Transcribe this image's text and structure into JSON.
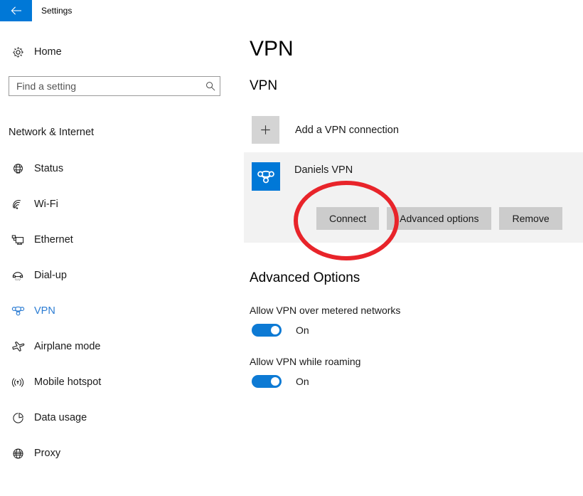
{
  "window": {
    "back_icon": "back-arrow-icon",
    "title": "Settings",
    "accent_color": "#0078d7"
  },
  "sidebar": {
    "home": {
      "icon": "gear-icon",
      "label": "Home"
    },
    "search": {
      "icon": "search-icon",
      "value": "",
      "placeholder": "Find a setting"
    },
    "group_label": "Network & Internet",
    "items": [
      {
        "icon": "globe-icon",
        "label": "Status",
        "selected": false
      },
      {
        "icon": "wifi-icon",
        "label": "Wi-Fi",
        "selected": false
      },
      {
        "icon": "ethernet-icon",
        "label": "Ethernet",
        "selected": false
      },
      {
        "icon": "dialup-phone-icon",
        "label": "Dial-up",
        "selected": false
      },
      {
        "icon": "vpn-icon",
        "label": "VPN",
        "selected": true
      },
      {
        "icon": "airplane-icon",
        "label": "Airplane mode",
        "selected": false
      },
      {
        "icon": "mobile-hotspot-icon",
        "label": "Mobile hotspot",
        "selected": false
      },
      {
        "icon": "pie-chart-icon",
        "label": "Data usage",
        "selected": false
      },
      {
        "icon": "globe-icon",
        "label": "Proxy",
        "selected": false
      }
    ],
    "selected_color": "#2b7cd3"
  },
  "main": {
    "page_title": "VPN",
    "section_title": "VPN",
    "add_connection": {
      "icon": "plus-icon",
      "label": "Add a VPN connection"
    },
    "connection": {
      "icon": "vpn-tile-icon",
      "name": "Daniels VPN",
      "buttons": [
        {
          "label": "Connect",
          "name": "connect-button"
        },
        {
          "label": "Advanced options",
          "name": "advanced-options-button"
        },
        {
          "label": "Remove",
          "name": "remove-button"
        }
      ]
    },
    "advanced": {
      "title": "Advanced Options",
      "options": [
        {
          "label": "Allow VPN over metered networks",
          "state": "On",
          "on": true
        },
        {
          "label": "Allow VPN while roaming",
          "state": "On",
          "on": true
        }
      ]
    }
  },
  "annotation": {
    "shape": "ellipse",
    "color": "#e8242a",
    "target": "Connect"
  }
}
